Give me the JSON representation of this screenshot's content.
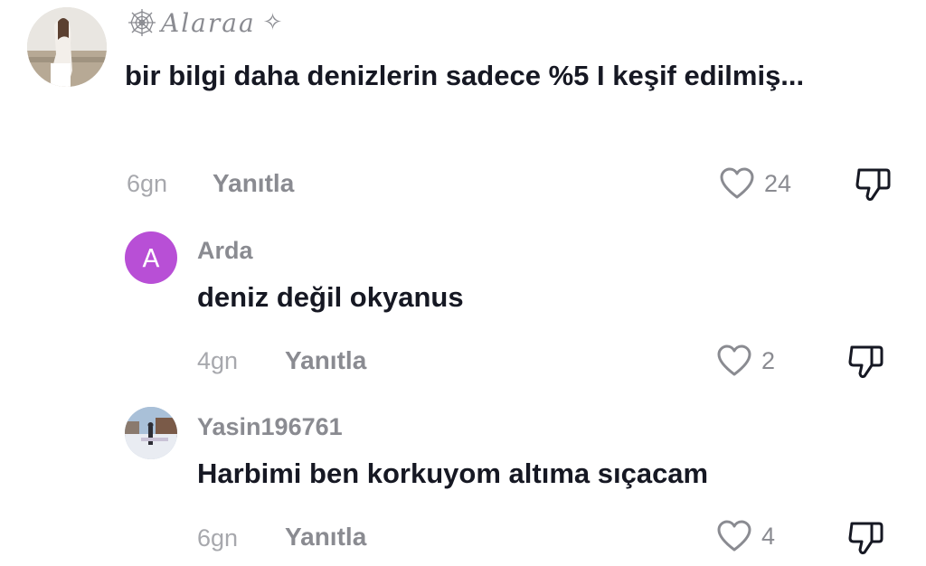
{
  "comments": [
    {
      "username": "Alaraa",
      "username_prefix_symbol": "spider-web-icon",
      "username_suffix_symbol": "✧",
      "text": "bir bilgi daha denizlerin sadece %5 I keşif edilmiş...",
      "time": "6gn",
      "reply_label": "Yanıtla",
      "likes": "24"
    },
    {
      "username": "Arda",
      "avatar_letter": "A",
      "text": "deniz değil okyanus",
      "time": "4gn",
      "reply_label": "Yanıtla",
      "likes": "2"
    },
    {
      "username": "Yasin196761",
      "text": "Harbimi ben korkuyom altıma sıçacam",
      "time": "6gn",
      "reply_label": "Yanıtla",
      "likes": "4"
    }
  ],
  "colors": {
    "letter_avatar_bg": "#b84fd6",
    "text_primary": "#161823",
    "text_secondary": "#8a8b91"
  }
}
